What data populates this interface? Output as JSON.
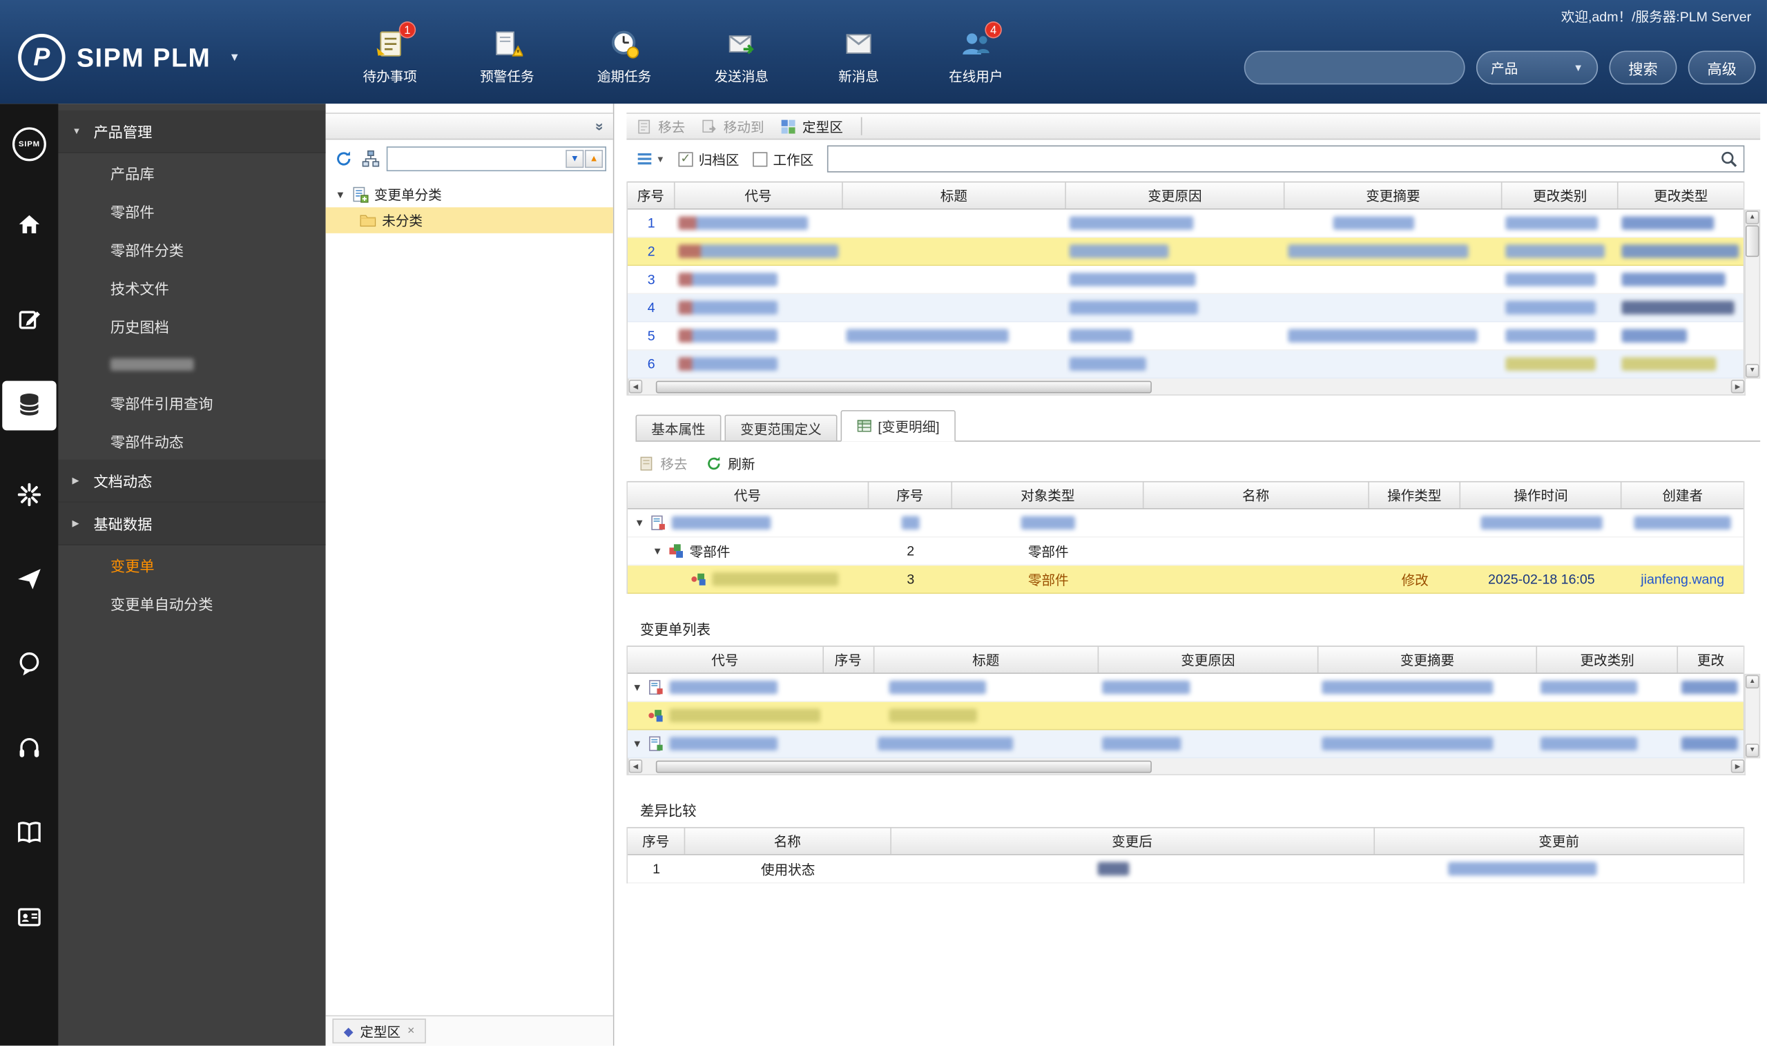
{
  "colors": {
    "header_bg": "#1d3f6d",
    "accent_orange": "#ff9000",
    "selected_row": "#fbf19c",
    "badge_red": "#e53022",
    "link_blue": "#1e4fd0"
  },
  "header": {
    "welcome": "欢迎,adm！/服务器:PLM Server",
    "logo_text": "SIPM PLM",
    "nav": [
      {
        "label": "待办事项",
        "badge": "1",
        "icon": "todo-icon"
      },
      {
        "label": "预警任务",
        "icon": "alert-icon"
      },
      {
        "label": "逾期任务",
        "icon": "overdue-icon"
      },
      {
        "label": "发送消息",
        "icon": "send-message-icon"
      },
      {
        "label": "新消息",
        "icon": "new-message-icon"
      },
      {
        "label": "在线用户",
        "badge": "4",
        "icon": "online-users-icon"
      }
    ],
    "search": {
      "value": "",
      "scope": "产品",
      "search_btn": "搜索",
      "advanced_btn": "高级"
    }
  },
  "sidebar": {
    "product_section": "产品管理",
    "product_items": [
      "产品库",
      "零部件",
      "零部件分类",
      "技术文件",
      "历史图档"
    ],
    "product_items_tail": [
      "零部件引用查询",
      "零部件动态"
    ],
    "doc_section": "文档动态",
    "base_section": "基础数据",
    "change_order": "变更单",
    "change_auto": "变更单自动分类"
  },
  "tree": {
    "root_label": "变更单分类",
    "child_label": "未分类",
    "bottom_tab": "定型区"
  },
  "main": {
    "toolbar": {
      "remove": "移去",
      "move_to": "移动到",
      "finalize": "定型区"
    },
    "filters": {
      "archive": "归档区",
      "workspace": "工作区"
    },
    "table1": {
      "columns": [
        "序号",
        "代号",
        "标题",
        "变更原因",
        "变更摘要",
        "更改类别",
        "更改类型"
      ],
      "row_seqs": [
        "1",
        "2",
        "3",
        "4",
        "5",
        "6"
      ]
    },
    "tabs": [
      "基本属性",
      "变更范围定义",
      "[变更明细]"
    ],
    "detail": {
      "toolbar": {
        "remove": "移去",
        "refresh": "刷新"
      },
      "columns": [
        "代号",
        "序号",
        "对象类型",
        "名称",
        "操作类型",
        "操作时间",
        "创建者"
      ],
      "row2": {
        "code": "零部件",
        "seq": "2",
        "type": "零部件"
      },
      "row3": {
        "seq": "3",
        "type": "零部件",
        "op": "修改",
        "time": "2025-02-18 16:05",
        "creator": "jianfeng.wang"
      }
    },
    "change_list": {
      "title": "变更单列表",
      "columns": [
        "代号",
        "序号",
        "标题",
        "变更原因",
        "变更摘要",
        "更改类别",
        "更改"
      ]
    },
    "diff": {
      "title": "差异比较",
      "columns": [
        "序号",
        "名称",
        "变更后",
        "变更前"
      ],
      "row": {
        "seq": "1",
        "name": "使用状态"
      }
    }
  }
}
